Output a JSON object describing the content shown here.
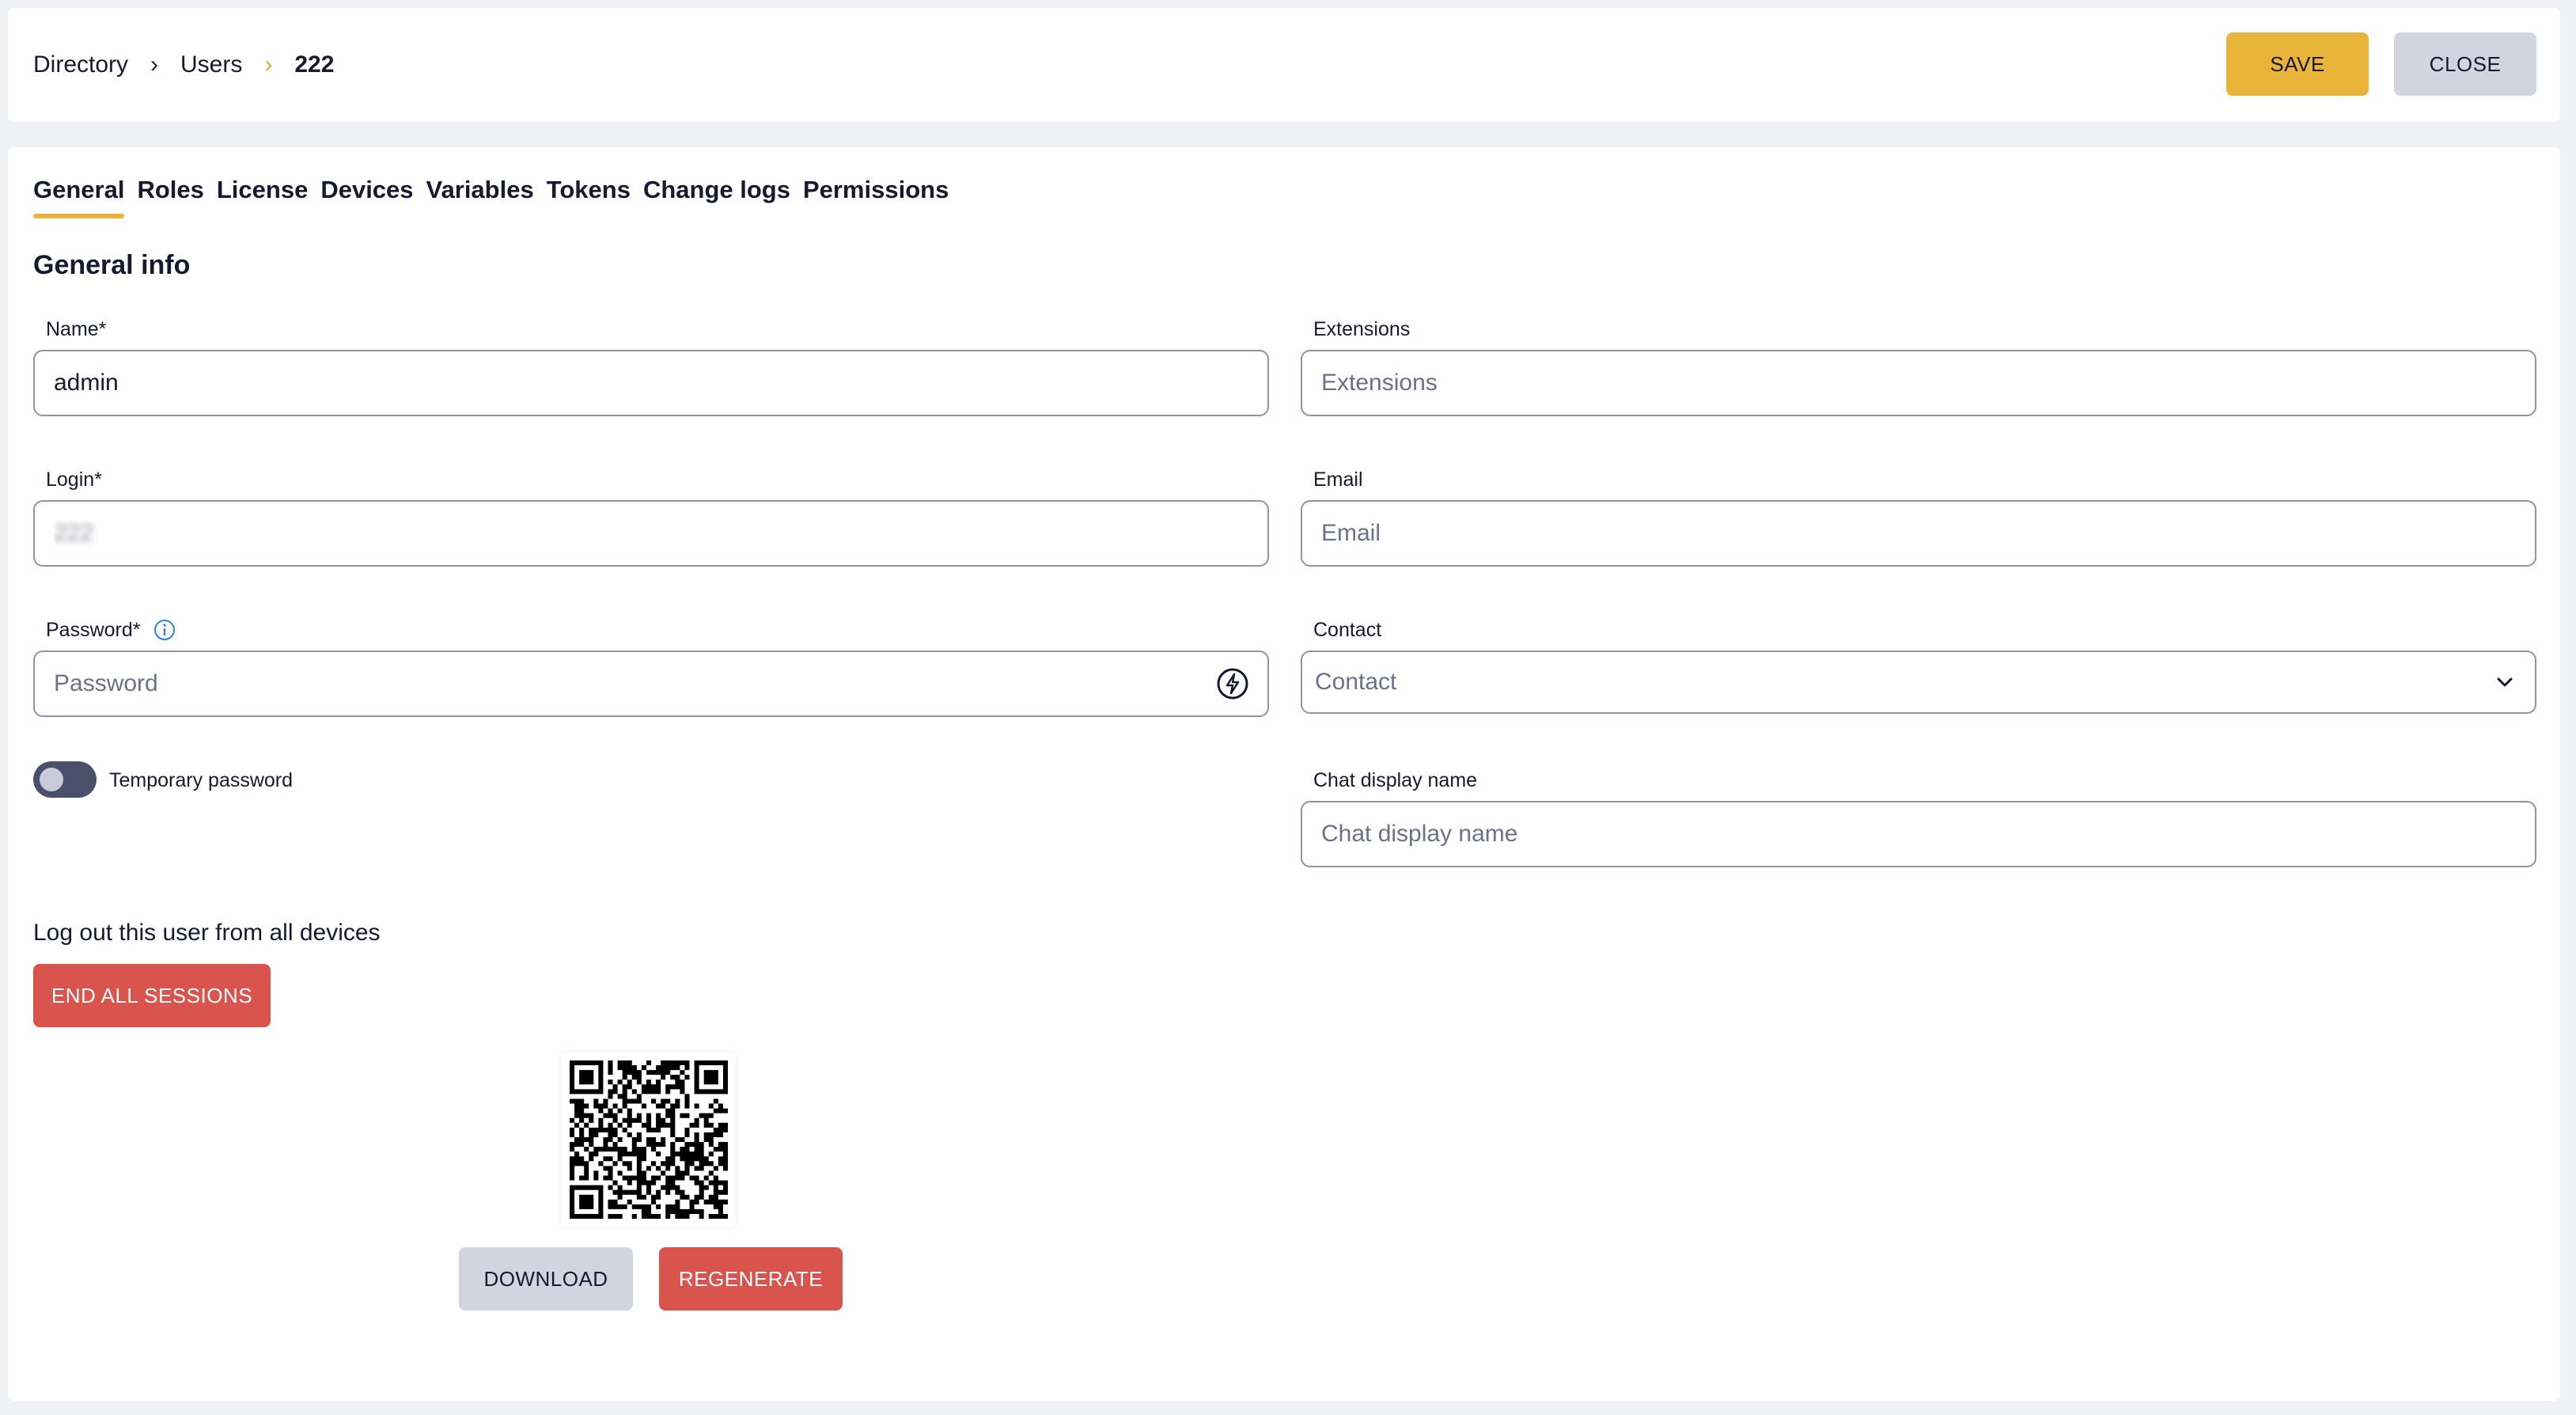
{
  "breadcrumb": {
    "items": [
      "Directory",
      "Users"
    ],
    "current": "222"
  },
  "header": {
    "save_label": "SAVE",
    "close_label": "CLOSE"
  },
  "tabs": [
    {
      "label": "General",
      "active": true
    },
    {
      "label": "Roles"
    },
    {
      "label": "License"
    },
    {
      "label": "Devices"
    },
    {
      "label": "Variables"
    },
    {
      "label": "Tokens"
    },
    {
      "label": "Change logs"
    },
    {
      "label": "Permissions"
    }
  ],
  "section_title": "General info",
  "form": {
    "name": {
      "label": "Name*",
      "value": "admin"
    },
    "extensions": {
      "label": "Extensions",
      "placeholder": "Extensions"
    },
    "login": {
      "label": "Login*",
      "value": "222"
    },
    "email": {
      "label": "Email",
      "placeholder": "Email"
    },
    "password": {
      "label": "Password*",
      "placeholder": "Password"
    },
    "contact": {
      "label": "Contact",
      "placeholder": "Contact"
    },
    "temporary_password": {
      "label": "Temporary password",
      "enabled": false
    },
    "chat_display_name": {
      "label": "Chat display name",
      "placeholder": "Chat display name"
    }
  },
  "sessions": {
    "text": "Log out this user from all devices",
    "button_label": "END ALL SESSIONS"
  },
  "qr": {
    "download_label": "DOWNLOAD",
    "regenerate_label": "REGENERATE"
  },
  "colors": {
    "accent": "#e9b43a",
    "danger": "#d9544d",
    "secondary": "#d3d5de",
    "info": "#2f80ed"
  },
  "icons": {
    "breadcrumb_separator": "chevron-right-icon",
    "password_generate": "lightning-icon",
    "password_info": "info-icon",
    "contact_dropdown": "chevron-down-icon"
  }
}
